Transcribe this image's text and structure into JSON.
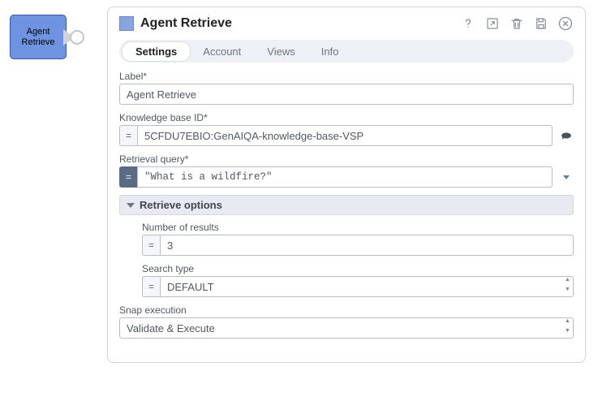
{
  "snap_node": {
    "label": "Agent\nRetrieve"
  },
  "header": {
    "title": "Agent Retrieve"
  },
  "tabs": {
    "items": [
      {
        "label": "Settings",
        "active": true
      },
      {
        "label": "Account",
        "active": false
      },
      {
        "label": "Views",
        "active": false
      },
      {
        "label": "Info",
        "active": false
      }
    ]
  },
  "fields": {
    "label": {
      "label": "Label*",
      "value": "Agent Retrieve"
    },
    "kb_id": {
      "label": "Knowledge base ID*",
      "value": "5CFDU7EBIO:GenAIQA-knowledge-base-VSP"
    },
    "query": {
      "label": "Retrieval query*",
      "value": "\"What is a wildfire?\""
    },
    "section": {
      "title": "Retrieve options"
    },
    "num_results": {
      "label": "Number of results",
      "value": "3"
    },
    "search_type": {
      "label": "Search type",
      "value": "DEFAULT"
    },
    "snap_exec": {
      "label": "Snap execution",
      "value": "Validate & Execute"
    }
  }
}
